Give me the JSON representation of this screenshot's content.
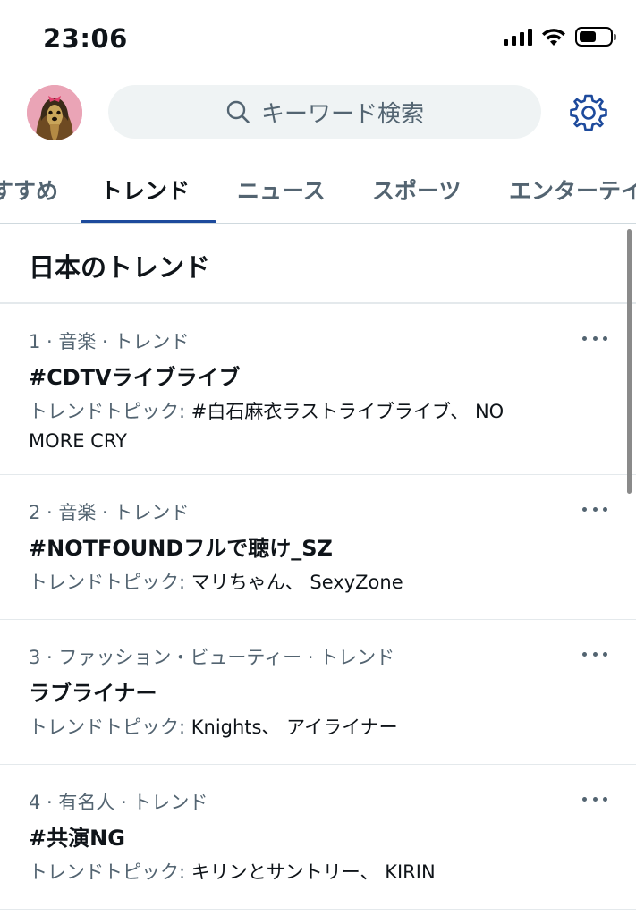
{
  "status_bar": {
    "time": "23:06",
    "battery_level": 0.55
  },
  "header": {
    "avatar_icon": "yorkshire-terrier-avatar",
    "search": {
      "placeholder": "キーワード検索",
      "icon": "search-icon"
    },
    "settings_icon": "gear-icon"
  },
  "tabs": [
    {
      "label": "すすめ",
      "active": false
    },
    {
      "label": "トレンド",
      "active": true
    },
    {
      "label": "ニュース",
      "active": false
    },
    {
      "label": "スポーツ",
      "active": false
    },
    {
      "label": "エンターテイ",
      "active": false
    }
  ],
  "colors": {
    "accent": "#1d4a9c",
    "text": "#0f1419",
    "secondary": "#536471",
    "search_bg": "#eff3f4"
  },
  "section_title": "日本のトレンド",
  "trends": [
    {
      "meta": "1 · 音楽 · トレンド",
      "title": "#CDTVライブライブ",
      "topic_label": "トレンドトピック: ",
      "topic_values": "#白石麻衣ラストライブライブ、 NO MORE CRY"
    },
    {
      "meta": "2 · 音楽 · トレンド",
      "title": "#NOTFOUNDフルで聴け_SZ",
      "topic_label": "トレンドトピック: ",
      "topic_values": "マリちゃん、 SexyZone"
    },
    {
      "meta": "3 · ファッション・ビューティー · トレンド",
      "title": "ラブライナー",
      "topic_label": "トレンドトピック: ",
      "topic_values": "Knights、 アイライナー"
    },
    {
      "meta": "4 · 有名人 · トレンド",
      "title": "#共演NG",
      "topic_label": "トレンドトピック: ",
      "topic_values": "キリンとサントリー、 KIRIN"
    }
  ]
}
